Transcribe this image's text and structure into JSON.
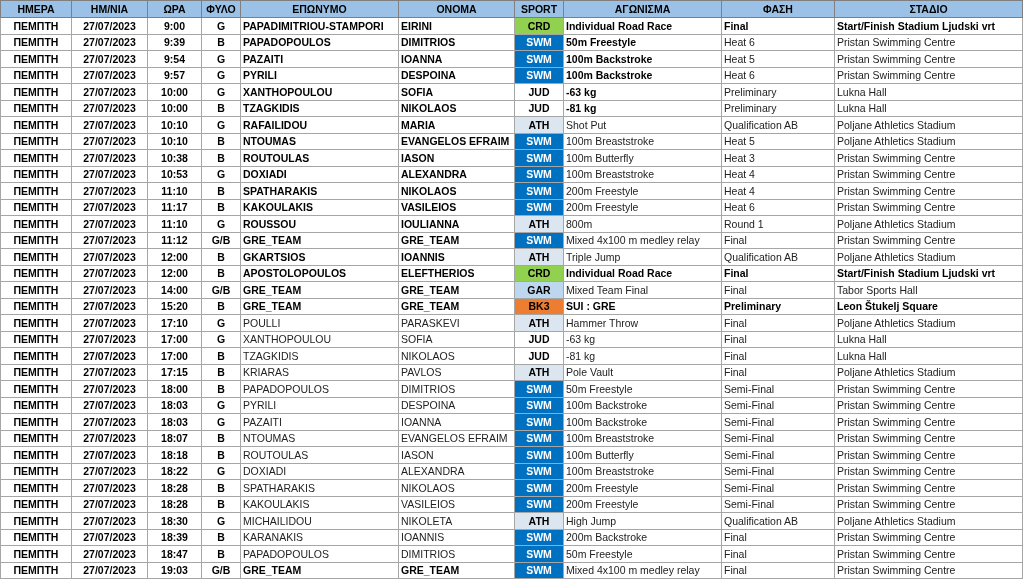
{
  "table": {
    "columns": [
      "ΗΜΕΡΑ",
      "ΗΜ/ΝΙΑ",
      "ΩΡΑ",
      "ΦΥΛΟ",
      "ΕΠΩΝΥΜΟ",
      "ΟΝΟΜΑ",
      "SPORT",
      "ΑΓΩΝΙΣΜΑ",
      "ΦΑΣΗ",
      "ΣΤΑΔΙΟ"
    ],
    "rows": [
      {
        "cells": [
          "ΠΕΜΠΤΗ",
          "27/07/2023",
          "9:00",
          "G",
          "PAPADIMITRIOU-STAMPORI",
          "EIRINI",
          "CRD",
          "Individual Road Race",
          "Final",
          "Start/Finish Stadium Ljudski vrt"
        ],
        "color": "#92d050",
        "athlete_bold": true,
        "event_bold": true,
        "place_bold": true
      },
      {
        "cells": [
          "ΠΕΜΠΤΗ",
          "27/07/2023",
          "9:39",
          "B",
          "PAPADOPOULOS",
          "DIMITRIOS",
          "SWM",
          "50m Freestyle",
          "Heat 6",
          "Pristan Swimming Centre"
        ],
        "color": "#0070c0",
        "athlete_bold": true,
        "event_bold": true,
        "place_bold": false
      },
      {
        "cells": [
          "ΠΕΜΠΤΗ",
          "27/07/2023",
          "9:54",
          "G",
          "PAZAITI",
          "IOANNA",
          "SWM",
          "100m Backstroke",
          "Heat 5",
          "Pristan Swimming Centre"
        ],
        "color": "#0070c0",
        "athlete_bold": true,
        "event_bold": true,
        "place_bold": false
      },
      {
        "cells": [
          "ΠΕΜΠΤΗ",
          "27/07/2023",
          "9:57",
          "G",
          "PYRILI",
          "DESPOINA",
          "SWM",
          "100m Backstroke",
          "Heat 6",
          "Pristan Swimming Centre"
        ],
        "color": "#0070c0",
        "athlete_bold": true,
        "event_bold": true,
        "place_bold": false
      },
      {
        "cells": [
          "ΠΕΜΠΤΗ",
          "27/07/2023",
          "10:00",
          "G",
          "XANTHOPOULOU",
          "SOFIA",
          "JUD",
          "-63 kg",
          "Preliminary",
          "Lukna Hall"
        ],
        "color": "#ffffff",
        "athlete_bold": true,
        "event_bold": true,
        "place_bold": false
      },
      {
        "cells": [
          "ΠΕΜΠΤΗ",
          "27/07/2023",
          "10:00",
          "B",
          "TZAGKIDIS",
          "NIKOLAOS",
          "JUD",
          "-81 kg",
          "Preliminary",
          "Lukna Hall"
        ],
        "color": "#ffffff",
        "athlete_bold": true,
        "event_bold": true,
        "place_bold": false
      },
      {
        "cells": [
          "ΠΕΜΠΤΗ",
          "27/07/2023",
          "10:10",
          "G",
          "RAFAILIDOU",
          "MARIA",
          "ATH",
          "Shot Put",
          "Qualification AB",
          "Poljane Athletics Stadium"
        ],
        "color": "#dce6f1",
        "athlete_bold": true,
        "event_bold": false,
        "place_bold": false
      },
      {
        "cells": [
          "ΠΕΜΠΤΗ",
          "27/07/2023",
          "10:10",
          "B",
          "NTOUMAS",
          "EVANGELOS EFRAIM",
          "SWM",
          "100m Breaststroke",
          "Heat 5",
          "Poljane Athletics Stadium"
        ],
        "color": "#0070c0",
        "athlete_bold": true,
        "event_bold": false,
        "place_bold": false
      },
      {
        "cells": [
          "ΠΕΜΠΤΗ",
          "27/07/2023",
          "10:38",
          "B",
          "ROUTOULAS",
          "IASON",
          "SWM",
          "100m Butterfly",
          "Heat 3",
          "Pristan Swimming Centre"
        ],
        "color": "#0070c0",
        "athlete_bold": true,
        "event_bold": false,
        "place_bold": false
      },
      {
        "cells": [
          "ΠΕΜΠΤΗ",
          "27/07/2023",
          "10:53",
          "G",
          "DOXIADI",
          "ALEXANDRA",
          "SWM",
          "100m Breaststroke",
          "Heat 4",
          "Pristan Swimming Centre"
        ],
        "color": "#0070c0",
        "athlete_bold": true,
        "event_bold": false,
        "place_bold": false
      },
      {
        "cells": [
          "ΠΕΜΠΤΗ",
          "27/07/2023",
          "11:10",
          "B",
          "SPATHARAKIS",
          "NIKOLAOS",
          "SWM",
          "200m Freestyle",
          "Heat 4",
          "Pristan Swimming Centre"
        ],
        "color": "#0070c0",
        "athlete_bold": true,
        "event_bold": false,
        "place_bold": false
      },
      {
        "cells": [
          "ΠΕΜΠΤΗ",
          "27/07/2023",
          "11:17",
          "B",
          "KAKOULAKIS",
          "VASILEIOS",
          "SWM",
          "200m Freestyle",
          "Heat 6",
          "Pristan Swimming Centre"
        ],
        "color": "#0070c0",
        "athlete_bold": true,
        "event_bold": false,
        "place_bold": false
      },
      {
        "cells": [
          "ΠΕΜΠΤΗ",
          "27/07/2023",
          "11:10",
          "G",
          "ROUSSOU",
          "IOULIANNA",
          "ATH",
          "800m",
          "Round 1",
          "Poljane Athletics Stadium"
        ],
        "color": "#dce6f1",
        "athlete_bold": true,
        "event_bold": false,
        "place_bold": false
      },
      {
        "cells": [
          "ΠΕΜΠΤΗ",
          "27/07/2023",
          "11:12",
          "G/B",
          "GRE_TEAM",
          "GRE_TEAM",
          "SWM",
          "Mixed 4x100 m medley relay",
          "Final",
          "Pristan Swimming Centre"
        ],
        "color": "#0070c0",
        "athlete_bold": true,
        "event_bold": false,
        "place_bold": false
      },
      {
        "cells": [
          "ΠΕΜΠΤΗ",
          "27/07/2023",
          "12:00",
          "B",
          "GKARTSIOS",
          "IOANNIS",
          "ATH",
          "Triple Jump",
          "Qualification AB",
          "Poljane Athletics Stadium"
        ],
        "color": "#dce6f1",
        "athlete_bold": true,
        "event_bold": false,
        "place_bold": false
      },
      {
        "cells": [
          "ΠΕΜΠΤΗ",
          "27/07/2023",
          "12:00",
          "B",
          "APOSTOLOPOULOS",
          "ELEFTHERIOS",
          "CRD",
          "Individual Road Race",
          "Final",
          "Start/Finish Stadium Ljudski vrt"
        ],
        "color": "#92d050",
        "athlete_bold": true,
        "event_bold": true,
        "place_bold": true
      },
      {
        "cells": [
          "ΠΕΜΠΤΗ",
          "27/07/2023",
          "14:00",
          "G/B",
          "GRE_TEAM",
          "GRE_TEAM",
          "GAR",
          "Mixed Team Final",
          "Final",
          "Tabor Sports Hall"
        ],
        "color": "#bdd7ee",
        "athlete_bold": true,
        "event_bold": false,
        "place_bold": false
      },
      {
        "cells": [
          "ΠΕΜΠΤΗ",
          "27/07/2023",
          "15:20",
          "B",
          "GRE_TEAM",
          "GRE_TEAM",
          "BK3",
          "SUI : GRE",
          "Preliminary",
          "Leon Štukelj Square"
        ],
        "color": "#ed7d31",
        "athlete_bold": true,
        "event_bold": true,
        "place_bold": true
      },
      {
        "cells": [
          "ΠΕΜΠΤΗ",
          "27/07/2023",
          "17:10",
          "G",
          "POULLI",
          "PARASKEVI",
          "ATH",
          "Hammer Throw",
          "Final",
          "Poljane Athletics Stadium"
        ],
        "color": "#dce6f1",
        "athlete_bold": false,
        "event_bold": false,
        "place_bold": false
      },
      {
        "cells": [
          "ΠΕΜΠΤΗ",
          "27/07/2023",
          "17:00",
          "G",
          "XANTHOPOULOU",
          "SOFIA",
          "JUD",
          "-63 kg",
          "Final",
          "Lukna Hall"
        ],
        "color": "#ffffff",
        "athlete_bold": false,
        "event_bold": false,
        "place_bold": false
      },
      {
        "cells": [
          "ΠΕΜΠΤΗ",
          "27/07/2023",
          "17:00",
          "B",
          "TZAGKIDIS",
          "NIKOLAOS",
          "JUD",
          "-81 kg",
          "Final",
          "Lukna Hall"
        ],
        "color": "#ffffff",
        "athlete_bold": false,
        "event_bold": false,
        "place_bold": false
      },
      {
        "cells": [
          "ΠΕΜΠΤΗ",
          "27/07/2023",
          "17:15",
          "B",
          "KRIARAS",
          "PAVLOS",
          "ATH",
          "Pole Vault",
          "Final",
          "Poljane Athletics Stadium"
        ],
        "color": "#dce6f1",
        "athlete_bold": false,
        "event_bold": false,
        "place_bold": false
      },
      {
        "cells": [
          "ΠΕΜΠΤΗ",
          "27/07/2023",
          "18:00",
          "B",
          "PAPADOPOULOS",
          "DIMITRIOS",
          "SWM",
          "50m Freestyle",
          "Semi-Final",
          "Pristan Swimming Centre"
        ],
        "color": "#0070c0",
        "athlete_bold": false,
        "event_bold": false,
        "place_bold": false
      },
      {
        "cells": [
          "ΠΕΜΠΤΗ",
          "27/07/2023",
          "18:03",
          "G",
          "PYRILI",
          "DESPOINA",
          "SWM",
          "100m Backstroke",
          "Semi-Final",
          "Pristan Swimming Centre"
        ],
        "color": "#0070c0",
        "athlete_bold": false,
        "event_bold": false,
        "place_bold": false
      },
      {
        "cells": [
          "ΠΕΜΠΤΗ",
          "27/07/2023",
          "18:03",
          "G",
          "PAZAITI",
          "IOANNA",
          "SWM",
          "100m Backstroke",
          "Semi-Final",
          "Pristan Swimming Centre"
        ],
        "color": "#0070c0",
        "athlete_bold": false,
        "event_bold": false,
        "place_bold": false
      },
      {
        "cells": [
          "ΠΕΜΠΤΗ",
          "27/07/2023",
          "18:07",
          "B",
          "NTOUMAS",
          "EVANGELOS EFRAIM",
          "SWM",
          "100m Breaststroke",
          "Semi-Final",
          "Pristan Swimming Centre"
        ],
        "color": "#0070c0",
        "athlete_bold": false,
        "event_bold": false,
        "place_bold": false
      },
      {
        "cells": [
          "ΠΕΜΠΤΗ",
          "27/07/2023",
          "18:18",
          "B",
          "ROUTOULAS",
          "IASON",
          "SWM",
          "100m Butterfly",
          "Semi-Final",
          "Pristan Swimming Centre"
        ],
        "color": "#0070c0",
        "athlete_bold": false,
        "event_bold": false,
        "place_bold": false
      },
      {
        "cells": [
          "ΠΕΜΠΤΗ",
          "27/07/2023",
          "18:22",
          "G",
          "DOXIADI",
          "ALEXANDRA",
          "SWM",
          "100m Breaststroke",
          "Semi-Final",
          "Pristan Swimming Centre"
        ],
        "color": "#0070c0",
        "athlete_bold": false,
        "event_bold": false,
        "place_bold": false
      },
      {
        "cells": [
          "ΠΕΜΠΤΗ",
          "27/07/2023",
          "18:28",
          "B",
          "SPATHARAKIS",
          "NIKOLAOS",
          "SWM",
          "200m Freestyle",
          "Semi-Final",
          "Pristan Swimming Centre"
        ],
        "color": "#0070c0",
        "athlete_bold": false,
        "event_bold": false,
        "place_bold": false
      },
      {
        "cells": [
          "ΠΕΜΠΤΗ",
          "27/07/2023",
          "18:28",
          "B",
          "KAKOULAKIS",
          "VASILEIOS",
          "SWM",
          "200m Freestyle",
          "Semi-Final",
          "Pristan Swimming Centre"
        ],
        "color": "#0070c0",
        "athlete_bold": false,
        "event_bold": false,
        "place_bold": false
      },
      {
        "cells": [
          "ΠΕΜΠΤΗ",
          "27/07/2023",
          "18:30",
          "G",
          "MICHAILIDOU",
          "NIKOLETA",
          "ATH",
          "High Jump",
          "Qualification AB",
          "Poljane Athletics Stadium"
        ],
        "color": "#dce6f1",
        "athlete_bold": false,
        "event_bold": false,
        "place_bold": false
      },
      {
        "cells": [
          "ΠΕΜΠΤΗ",
          "27/07/2023",
          "18:39",
          "B",
          "KARANAKIS",
          "IOANNIS",
          "SWM",
          "200m Backstroke",
          "Final",
          "Pristan Swimming Centre"
        ],
        "color": "#0070c0",
        "athlete_bold": false,
        "event_bold": false,
        "place_bold": false
      },
      {
        "cells": [
          "ΠΕΜΠΤΗ",
          "27/07/2023",
          "18:47",
          "B",
          "PAPADOPOULOS",
          "DIMITRIOS",
          "SWM",
          "50m Freestyle",
          "Final",
          "Pristan Swimming Centre"
        ],
        "color": "#0070c0",
        "athlete_bold": false,
        "event_bold": false,
        "place_bold": false
      },
      {
        "cells": [
          "ΠΕΜΠΤΗ",
          "27/07/2023",
          "19:03",
          "G/B",
          "GRE_TEAM",
          "GRE_TEAM",
          "SWM",
          "Mixed 4x100 m medley relay",
          "Final",
          "Pristan Swimming Centre"
        ],
        "color": "#0070c0",
        "athlete_bold": true,
        "event_bold": false,
        "place_bold": false
      }
    ]
  }
}
